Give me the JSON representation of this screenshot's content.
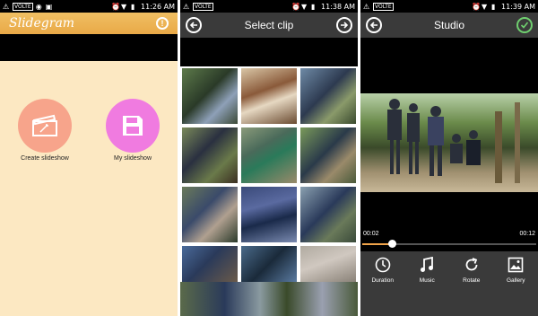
{
  "screens": [
    {
      "status": {
        "volte": "VOLTE",
        "time": "11:26 AM",
        "battery": "51"
      },
      "app_title": "Slidegram",
      "buttons": [
        {
          "label": "Create slideshow",
          "icon": "clapperboard-icon",
          "color": "#f7a48b"
        },
        {
          "label": "My slideshow",
          "icon": "floppy-disk-icon",
          "color": "#f07be0"
        }
      ]
    },
    {
      "status": {
        "volte": "VOLTE",
        "time": "11:38 AM",
        "battery": "51"
      },
      "title": "Select clip"
    },
    {
      "status": {
        "volte": "VOLTE",
        "time": "11:39 AM",
        "battery": "51"
      },
      "title": "Studio",
      "playback": {
        "current": "00:02",
        "total": "00:12",
        "progress": 0.17
      },
      "tools": [
        {
          "label": "Duration",
          "icon": "clock-icon"
        },
        {
          "label": "Music",
          "icon": "music-note-icon"
        },
        {
          "label": "Rotate",
          "icon": "rotate-icon"
        },
        {
          "label": "Gallery",
          "icon": "gallery-icon"
        }
      ]
    }
  ],
  "colors": {
    "appbar_orange": "#ebb050",
    "background_cream": "#fce8c2",
    "dark_bar": "#3a3a3a",
    "progress_accent": "#f0a44a",
    "check_green": "#6fcf6f"
  }
}
